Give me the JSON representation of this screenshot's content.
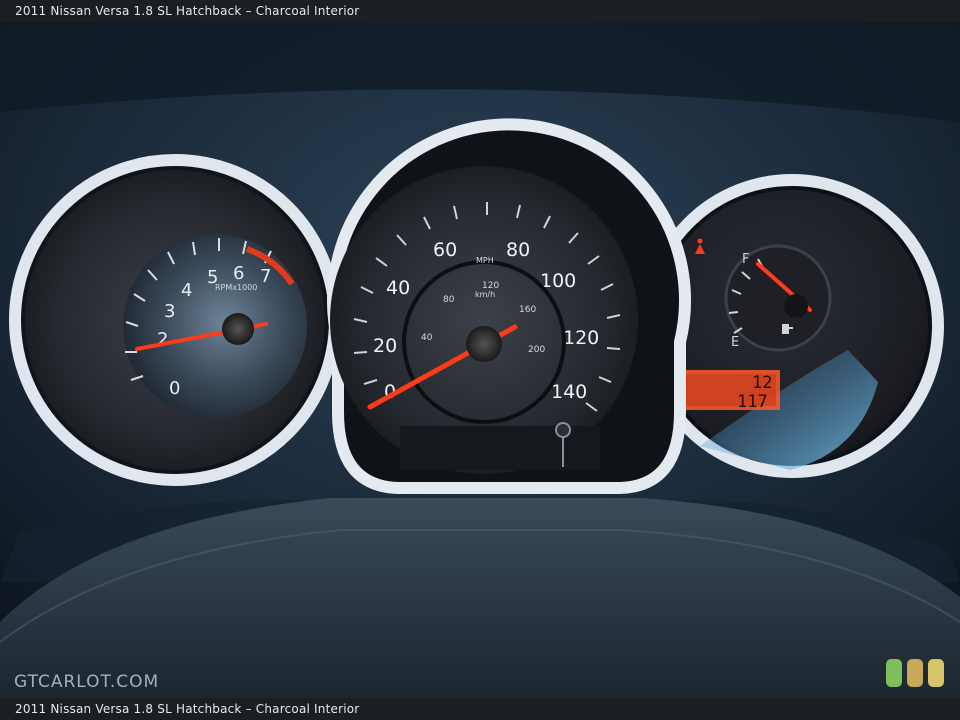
{
  "caption": {
    "top": "2011 Nissan Versa 1.8 SL Hatchback – Charcoal Interior",
    "bottom": "2011 Nissan Versa 1.8 SL Hatchback – Charcoal Interior"
  },
  "watermark": "GTCARLOT.COM",
  "tachometer": {
    "ticks": [
      "0",
      "2",
      "3",
      "4",
      "5",
      "6",
      "7"
    ],
    "unit": "RPMx1000"
  },
  "speedometer": {
    "mph_ticks": [
      "0",
      "20",
      "40",
      "60",
      "80",
      "100",
      "120",
      "140"
    ],
    "kmh_ticks": [
      "40",
      "80",
      "120",
      "160",
      "200"
    ],
    "mph_unit": "MPH",
    "kmh_unit": "km/h"
  },
  "fuel_gauge": {
    "full_label": "F",
    "empty_label": "E"
  },
  "odometer": {
    "line1": "12",
    "line2": "117"
  },
  "colors": {
    "needle": "#ff3a1a",
    "ring": "#dfe6ee",
    "display": "#ff5a2a"
  }
}
